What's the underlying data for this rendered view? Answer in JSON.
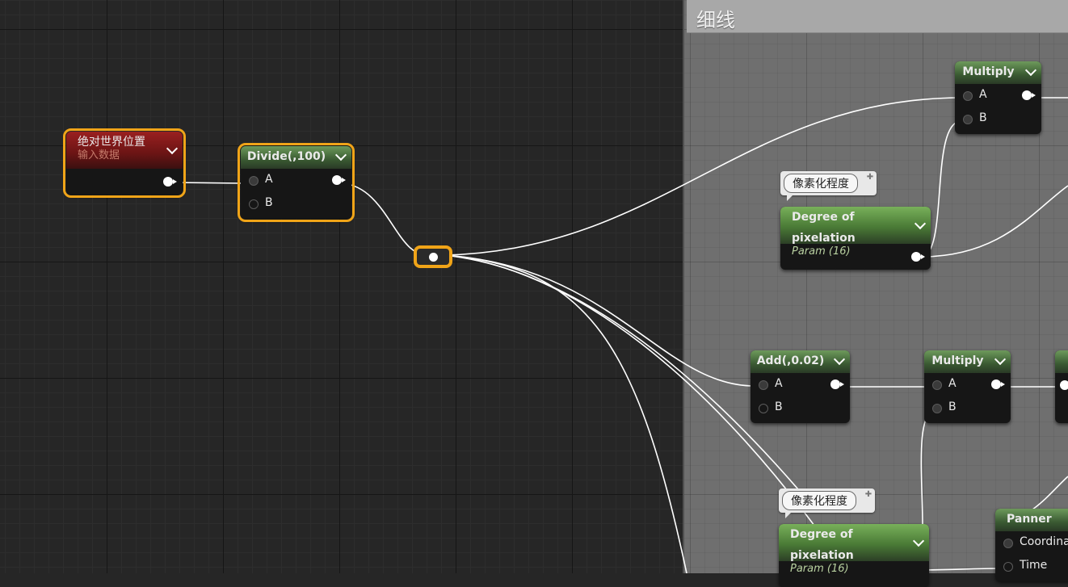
{
  "comment": {
    "title": "细线"
  },
  "nodes": {
    "world_position": {
      "title": "绝对世界位置",
      "subtitle": "输入数据"
    },
    "divide": {
      "title": "Divide(,100)",
      "pin_a": "A",
      "pin_b": "B"
    },
    "multiply_top": {
      "title": "Multiply",
      "pin_a": "A",
      "pin_b": "B"
    },
    "param_top": {
      "title": "Degree of pixelation",
      "subtitle": "Param (16)",
      "comment": "像素化程度"
    },
    "add": {
      "title": "Add(,0.02)",
      "pin_a": "A",
      "pin_b": "B"
    },
    "multiply_mid": {
      "title": "Multiply",
      "pin_a": "A",
      "pin_b": "B"
    },
    "param_bottom": {
      "title": "Degree of pixelation",
      "subtitle": "Param (16)",
      "comment": "像素化程度"
    },
    "panner": {
      "title": "Panner",
      "pin_coord": "Coordinat",
      "pin_time": "Time"
    }
  },
  "colors": {
    "selection": "#f0a418",
    "canvas_bg": "#262626",
    "comment_bg": "#6f6f6f",
    "wire": "#ffffff"
  },
  "icons": [
    "chevron-down-icon",
    "pin-icon",
    "exec-pin-icon"
  ]
}
